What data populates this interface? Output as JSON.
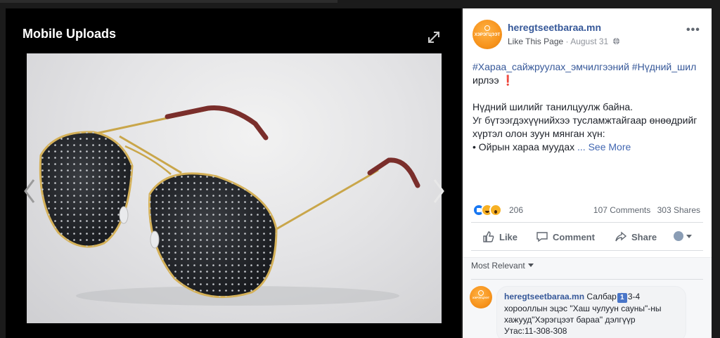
{
  "viewer": {
    "title": "Mobile Uploads"
  },
  "post": {
    "page_name": "heregtseetbaraa.mn",
    "avatar_text": "ХЭРЭГЦЭЭТ",
    "like_link": "Like This Page",
    "separator": "·",
    "date": "August 31",
    "text_tags": "#Хараа_сайжруулах_эмчилгээний #Нүдний_шил",
    "text_arrived": "ирлээ",
    "text_line1": "Нүдний шилийг танилцуулж байна.",
    "text_line2": "Уг бүтээгдэхүүнийхээ тусламжтайгаар өнөөдрийг хүртэл олон зуун мянган хүн:",
    "text_line3": "• Ойрын хараа муудах",
    "see_more": "... See More"
  },
  "stats": {
    "reaction_count": "206",
    "comments": "107 Comments",
    "shares": "303 Shares"
  },
  "actions": {
    "like": "Like",
    "comment": "Comment",
    "share": "Share"
  },
  "comments": {
    "sort_label": "Most Relevant",
    "first": {
      "author": "heregtseetbaraa.mn",
      "text_a": "Салбар",
      "badge": "1",
      "text_b": "3-4 хорооллын эцэс \"Хаш чулуун сауны\"-ны хажууд\"Хэрэгцээт бараа\" дэлгүүр",
      "phone": "Утас:11-308-308"
    }
  },
  "colors": {
    "link": "#365899",
    "avatar_orange": "#f7941d",
    "viewer_bg": "#000000"
  }
}
